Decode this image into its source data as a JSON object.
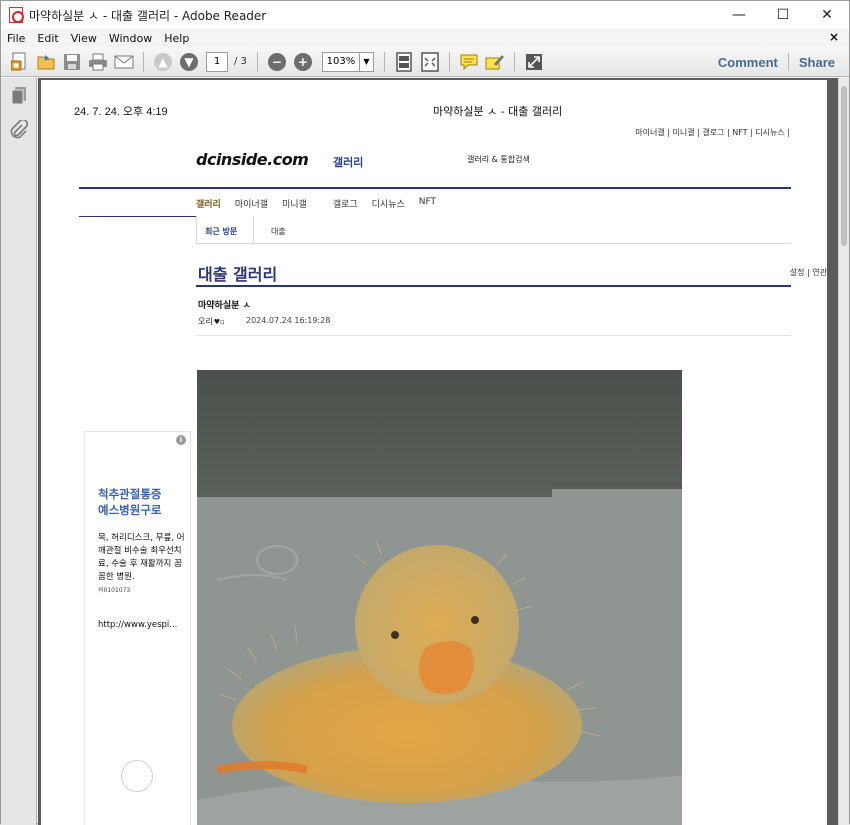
{
  "window": {
    "title": "마약하실분 ㅅ - 대출 갤러리 - Adobe Reader",
    "minimize": "—",
    "maximize": "☐",
    "close": "✕"
  },
  "menu": {
    "items": [
      "File",
      "Edit",
      "View",
      "Window",
      "Help"
    ],
    "close_doc": "×"
  },
  "toolbar": {
    "page_current": "1",
    "page_total": "/ 3",
    "zoom": "103%",
    "comment_label": "Comment",
    "share_label": "Share"
  },
  "page": {
    "print_date": "24. 7. 24. 오후 4:19",
    "print_title": "마약하실분 ㅅ - 대출 갤러리",
    "top_links": "마이너갤 | 미니갤 | 갤로그 | NFT | 디시뉴스 |",
    "logo": "dcinside.com",
    "logo_sub": "갤러리",
    "search_label": "갤러리 & 통합검색",
    "nav": [
      "갤러리",
      "마이너갤",
      "미니갤",
      "갤로그",
      "디시뉴스",
      "NFT"
    ],
    "sub_tabs": [
      "최근 방문",
      "대출"
    ],
    "gallery_title": "대출 갤러리",
    "gallery_links": "설정     | 연관",
    "post_title": "마약하실분 ㅅ",
    "post_author": "오리",
    "post_date": "2024.07.24 16:19:28"
  },
  "ad": {
    "info": "i",
    "headline_1": "척추관절통증",
    "headline_2": "예스병원구로",
    "body": "목, 허리디스크, 무릎, 어깨관절 비수술 최우선치료, 수술 후 재활까지 꼼꼼한 병원.",
    "note": "의0101073",
    "url": "http://www.yespi..."
  },
  "colors": {
    "accent": "#29367a",
    "ad_headline": "#3a63b1",
    "toolbar_text": "#4a6a93"
  }
}
